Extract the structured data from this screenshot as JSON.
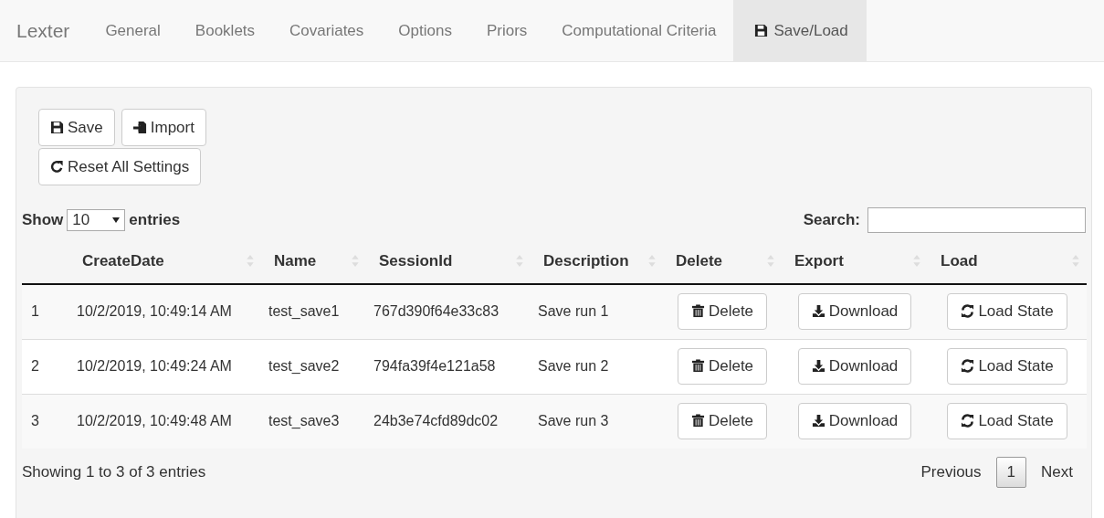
{
  "navbar": {
    "brand": "Lexter",
    "tabs": [
      {
        "label": "General",
        "selected": false
      },
      {
        "label": "Booklets",
        "selected": false
      },
      {
        "label": "Covariates",
        "selected": false
      },
      {
        "label": "Options",
        "selected": false
      },
      {
        "label": "Priors",
        "selected": false
      },
      {
        "label": "Computational Criteria",
        "selected": false
      },
      {
        "label": "Save/Load",
        "selected": true,
        "kind": "save"
      }
    ]
  },
  "toolbar": {
    "buttons": [
      {
        "label": "Save",
        "kind": "save"
      },
      {
        "label": "Import",
        "kind": "import"
      },
      {
        "label": "Reset All Settings",
        "kind": "reset"
      }
    ]
  },
  "length_control": {
    "before": "Show",
    "value": "10",
    "after": "entries"
  },
  "search": {
    "label": "Search:"
  },
  "table": {
    "columns": [
      {
        "sortable": false
      },
      {
        "label": "CreateDate",
        "sortable": true
      },
      {
        "label": "Name",
        "sortable": true
      },
      {
        "label": "SessionId",
        "sortable": true
      },
      {
        "label": "Description",
        "sortable": true
      },
      {
        "label": "Delete",
        "sortable": true
      },
      {
        "label": "Export",
        "sortable": true
      },
      {
        "label": "Load",
        "sortable": true
      }
    ],
    "rows": [
      {
        "cells": [
          "1",
          "10/2/2019, 10:49:14 AM",
          "test_save1",
          "767d390f64e33c83",
          "Save run 1"
        ],
        "actions": [
          {
            "label": "Delete",
            "kind": "delete"
          },
          {
            "label": "Download",
            "kind": "download"
          },
          {
            "label": "Load State",
            "kind": "load"
          }
        ]
      },
      {
        "cells": [
          "2",
          "10/2/2019, 10:49:24 AM",
          "test_save2",
          "794fa39f4e121a58",
          "Save run 2"
        ],
        "actions": [
          {
            "label": "Delete",
            "kind": "delete"
          },
          {
            "label": "Download",
            "kind": "download"
          },
          {
            "label": "Load State",
            "kind": "load"
          }
        ]
      },
      {
        "cells": [
          "3",
          "10/2/2019, 10:49:48 AM",
          "test_save3",
          "24b3e74cfd89dc02",
          "Save run 3"
        ],
        "actions": [
          {
            "label": "Delete",
            "kind": "delete"
          },
          {
            "label": "Download",
            "kind": "download"
          },
          {
            "label": "Load State",
            "kind": "load"
          }
        ]
      }
    ]
  },
  "info": "Showing 1 to 3 of 3 entries",
  "pagination": {
    "previous": "Previous",
    "pages": [
      {
        "label": "1",
        "selected": true
      }
    ],
    "next": "Next"
  }
}
